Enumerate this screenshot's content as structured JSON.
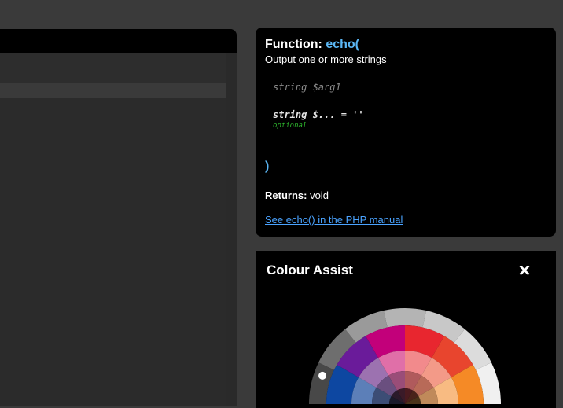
{
  "function_panel": {
    "label": "Function:",
    "name": "echo(",
    "description": "Output one or more strings",
    "params": [
      {
        "text": "string $arg1"
      },
      {
        "text": "string $... = ''",
        "note": "optional"
      }
    ],
    "closing": ")",
    "returns_label": "Returns:",
    "returns_value": "void",
    "manual_link": "See echo() in the PHP manual"
  },
  "colour_assist": {
    "title": "Colour Assist",
    "close_glyph": "✕",
    "ring_greys": [
      "#484848",
      "#6e6e6e",
      "#9a9a9a",
      "#b4b4b4",
      "#c8c8c8",
      "#dcdcdc",
      "#f0f0f0"
    ],
    "outer_colors": [
      "#0d47a1",
      "#6a1b9a",
      "#c2007a",
      "#e8262f",
      "#e8452e",
      "#f58a26"
    ],
    "middle_colors": [
      "#5c7fb8",
      "#9c72b0",
      "#e06fa8",
      "#f28a8c",
      "#f39a88",
      "#f8bb82"
    ],
    "inner_colors": [
      "#3c4d75",
      "#6a4f7f",
      "#9a4d78",
      "#b05a5c",
      "#b86a58",
      "#c08a5a"
    ],
    "center_colors": [
      "#1a1a2a",
      "#2a1a2a",
      "#3a1a28",
      "#4a1a1f",
      "#4a231a",
      "#4a331a"
    ]
  }
}
